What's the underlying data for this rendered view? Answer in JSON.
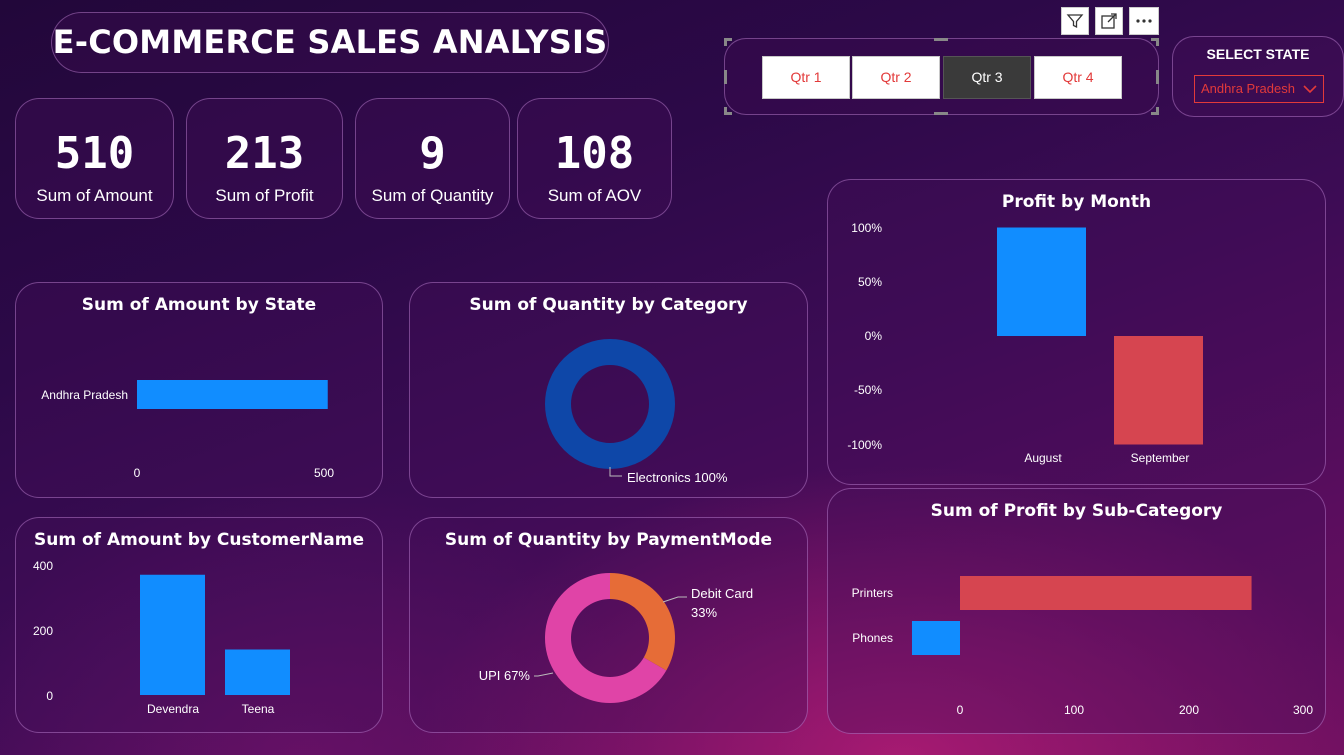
{
  "header": {
    "title": "E-COMMERCE SALES ANALYSIS"
  },
  "kpis": [
    {
      "value": "510",
      "label": "Sum of Amount"
    },
    {
      "value": "213",
      "label": "Sum of Profit"
    },
    {
      "value": "9",
      "label": "Sum of Quantity"
    },
    {
      "value": "108",
      "label": "Sum of AOV"
    }
  ],
  "quarter_slicer": {
    "options": [
      "Qtr 1",
      "Qtr 2",
      "Qtr 3",
      "Qtr 4"
    ],
    "selected": "Qtr 3"
  },
  "state_slicer": {
    "label": "SELECT STATE",
    "selected": "Andhra Pradesh"
  },
  "colors": {
    "blue": "#118dff",
    "red": "#d64550",
    "orange": "#e66c37",
    "pink": "#e044a7",
    "dark_blue": "#12239e"
  },
  "chart_data": [
    {
      "id": "amount_by_state",
      "type": "bar",
      "orientation": "horizontal",
      "title": "Sum of Amount by State",
      "categories": [
        "Andhra Pradesh"
      ],
      "values": [
        510
      ],
      "xticks": [
        "0",
        "500"
      ],
      "xlim": [
        0,
        600
      ]
    },
    {
      "id": "quantity_by_category",
      "type": "pie",
      "style": "donut",
      "title": "Sum of Quantity by Category",
      "categories": [
        "Electronics"
      ],
      "values": [
        9
      ],
      "labels": [
        "Electronics 100%"
      ]
    },
    {
      "id": "profit_by_month",
      "type": "bar",
      "title": "Profit by Month",
      "categories": [
        "August",
        "September"
      ],
      "values": [
        100,
        -100
      ],
      "yticks": [
        "100%",
        "50%",
        "0%",
        "-50%",
        "-100%"
      ],
      "ylim": [
        -100,
        100
      ]
    },
    {
      "id": "amount_by_customer",
      "type": "bar",
      "title": "Sum of Amount by CustomerName",
      "categories": [
        "Devendra",
        "Teena"
      ],
      "values": [
        370,
        140
      ],
      "yticks": [
        "400",
        "200",
        "0"
      ],
      "ylim": [
        0,
        400
      ]
    },
    {
      "id": "quantity_by_payment",
      "type": "pie",
      "style": "donut",
      "title": "Sum of Quantity by PaymentMode",
      "categories": [
        "Debit Card",
        "UPI"
      ],
      "values": [
        3,
        6
      ],
      "labels": [
        "Debit Card",
        "33%",
        "UPI 67%"
      ]
    },
    {
      "id": "profit_by_subcategory",
      "type": "bar",
      "orientation": "horizontal",
      "title": "Sum of Profit by Sub-Category",
      "categories": [
        "Printers",
        "Phones"
      ],
      "values": [
        255,
        -42
      ],
      "xticks": [
        "0",
        "100",
        "200",
        "300"
      ],
      "xlim": [
        -50,
        300
      ]
    }
  ]
}
